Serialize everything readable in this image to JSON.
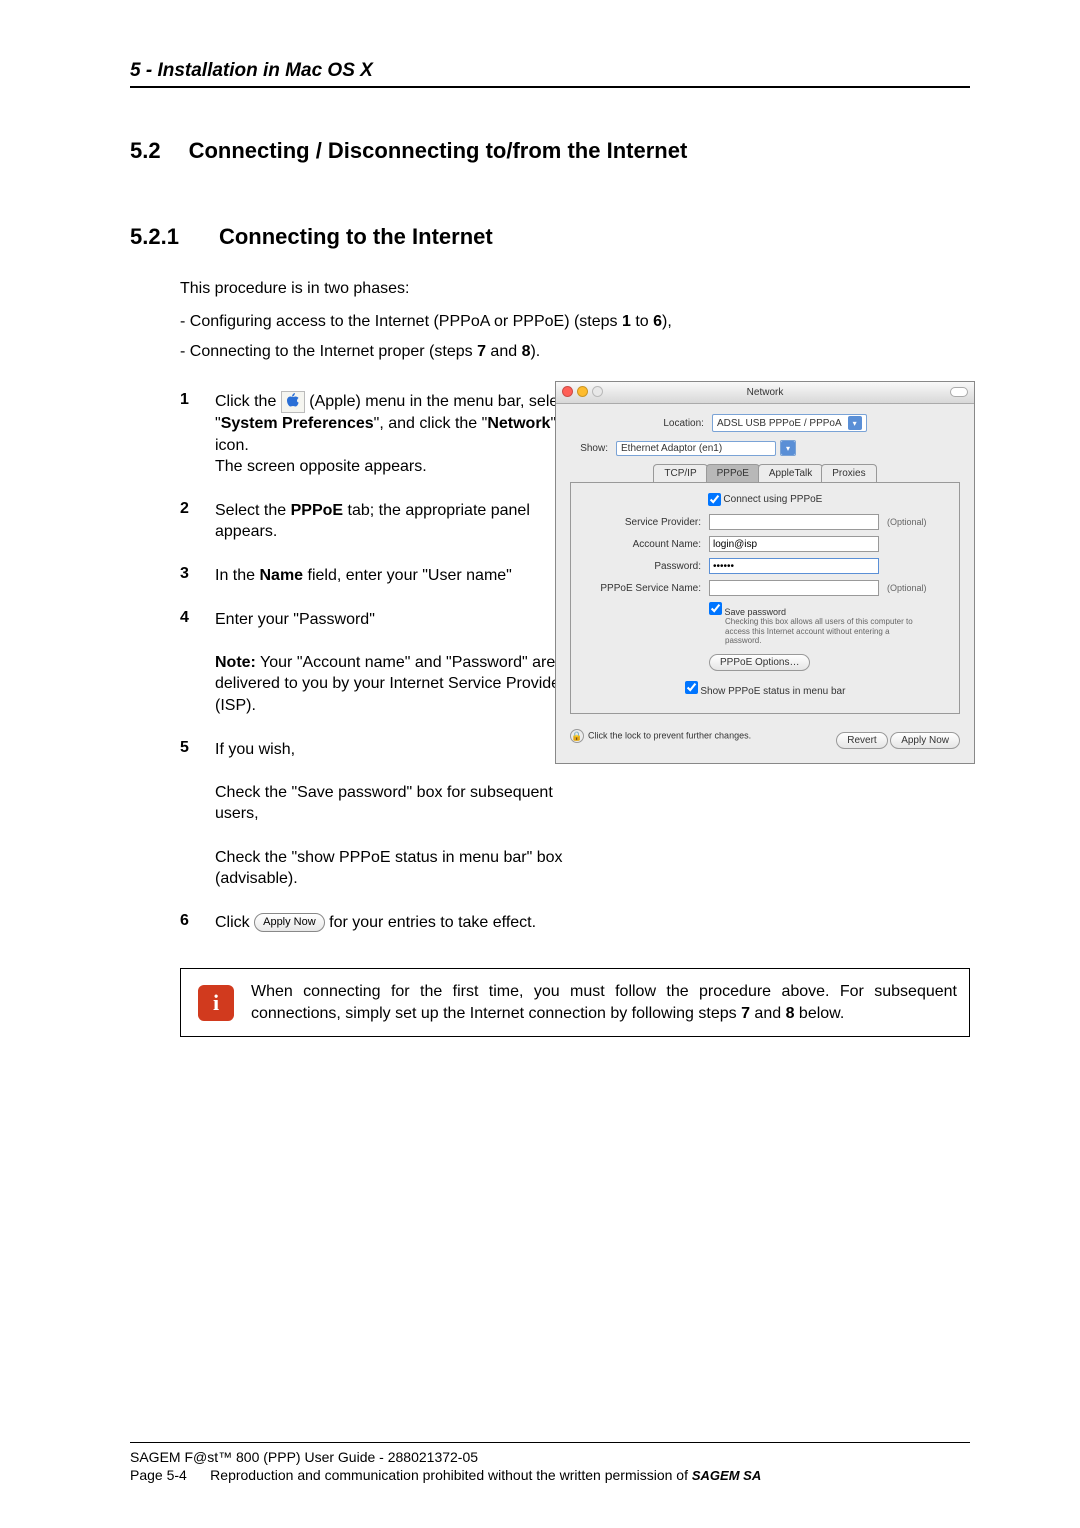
{
  "header": {
    "chapter": "5 - Installation in Mac OS X"
  },
  "section": {
    "num": "5.2",
    "title": "Connecting / Disconnecting to/from the Internet"
  },
  "subsection": {
    "num": "5.2.1",
    "title": "Connecting to the Internet"
  },
  "intro": "This procedure is in two phases:",
  "phase1": "- Configuring access to the Internet (PPPoA or PPPoE) (steps 1 to 6),",
  "phase2": "- Connecting to the Internet proper (steps 7 and 8).",
  "steps": {
    "s1": {
      "n": "1",
      "pre": "Click the ",
      "post": " (Apple) menu in the menu bar, select \"",
      "bold1": "System Preferences",
      "mid": "\", and click the \"",
      "bold2": "Network",
      "end": "\" icon.",
      "after": "The screen opposite appears."
    },
    "s2": {
      "n": "2",
      "pre": "Select the ",
      "bold": "PPPoE",
      "post": " tab; the appropriate panel appears."
    },
    "s3": {
      "n": "3",
      "pre": "In the ",
      "bold": "Name",
      "post": " field, enter your \"User name\""
    },
    "s4": {
      "n": "4",
      "text": "Enter your \"Password\"",
      "notelabel": "Note:",
      "note": " Your \"Account name\" and \"Password\" are delivered to you by your Internet Service Provider (ISP)."
    },
    "s5": {
      "n": "5",
      "text": "If you wish,",
      "p1": "Check the \"Save password\" box for subsequent users,",
      "p2": "Check the \"show PPPoE status in menu bar\" box (advisable)."
    },
    "s6": {
      "n": "6",
      "pre": "Click ",
      "btn": "Apply Now",
      "post": " for your entries to take effect."
    }
  },
  "noteBox": {
    "pre": "When connecting for the first time, you must follow the procedure above. For subsequent connections, simply set up the Internet connection by following steps ",
    "b1": "7",
    "mid": " and ",
    "b2": "8",
    "post": " below."
  },
  "mac": {
    "title": "Network",
    "locationLabel": "Location:",
    "locationValue": "ADSL USB PPPoE / PPPoA",
    "showLabel": "Show:",
    "showValue": "Ethernet Adaptor (en1)",
    "tabs": {
      "tcpip": "TCP/IP",
      "pppoe": "PPPoE",
      "appletalk": "AppleTalk",
      "proxies": "Proxies"
    },
    "connectUsing": "Connect using PPPoE",
    "serviceProvider": "Service Provider:",
    "accountName": "Account Name:",
    "accountValue": "login@isp",
    "password": "Password:",
    "passwordValue": "••••••",
    "pppoeServiceName": "PPPoE Service Name:",
    "optional": "(Optional)",
    "savePassword": "Save password",
    "saveHint": "Checking this box allows all users of this computer to access this Internet account without entering a password.",
    "pppoeOptions": "PPPoE Options…",
    "showStatus": "Show PPPoE status in menu bar",
    "lockText": "Click the lock to prevent further changes.",
    "revert": "Revert",
    "applyNow": "Apply Now"
  },
  "footer": {
    "line1": "SAGEM F@st™ 800 (PPP) User Guide - 288021372-05",
    "page": "Page 5-4",
    "line2": "Reproduction and communication prohibited without the written permission of ",
    "brand": "SAGEM SA"
  }
}
